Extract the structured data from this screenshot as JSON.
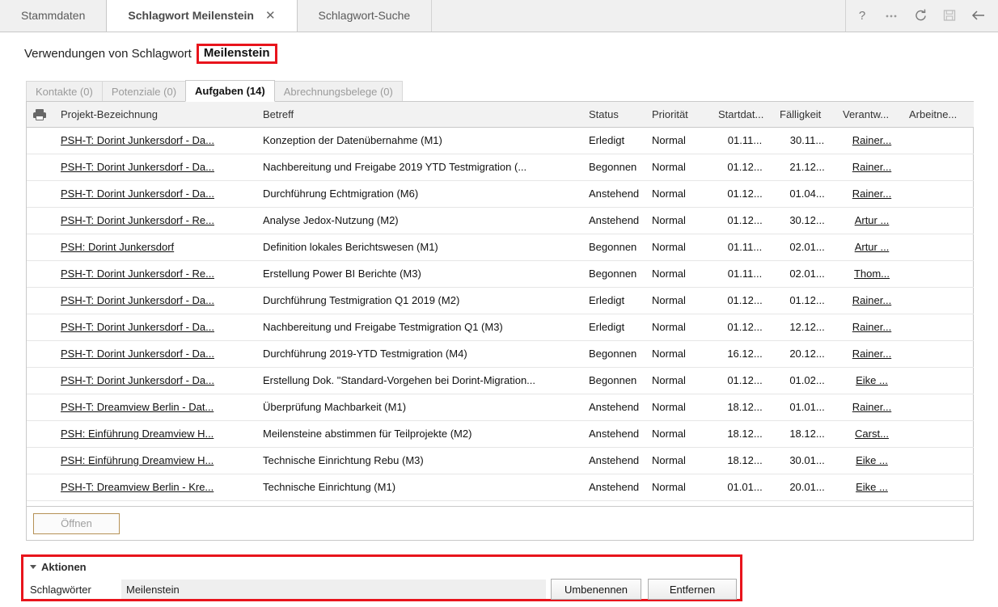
{
  "window": {
    "tabs": [
      {
        "label": "Stammdaten",
        "active": false,
        "closable": false
      },
      {
        "label": "Schlagwort Meilenstein",
        "active": true,
        "closable": true,
        "close_icon": "close-icon"
      },
      {
        "label": "Schlagwort-Suche",
        "active": false,
        "closable": false
      }
    ],
    "toolbar_icons": [
      {
        "name": "help-icon",
        "glyph": "?",
        "disabled": false
      },
      {
        "name": "more-options-icon",
        "glyph": "···",
        "disabled": false
      },
      {
        "name": "refresh-icon",
        "glyph": "↻",
        "disabled": false
      },
      {
        "name": "save-icon",
        "glyph": "὚b",
        "disabled": true
      },
      {
        "name": "back-arrow-icon",
        "glyph": "←",
        "disabled": false
      }
    ]
  },
  "header": {
    "prefix": "Verwendungen von Schlagwort",
    "keyword": "Meilenstein",
    "highlight_color": "#e8141c"
  },
  "subtabs": [
    {
      "label": "Kontakte (0)",
      "active": false
    },
    {
      "label": "Potenziale (0)",
      "active": false
    },
    {
      "label": "Aufgaben (14)",
      "active": true
    },
    {
      "label": "Abrechnungsbelege (0)",
      "active": false
    }
  ],
  "table": {
    "print_icon": "printer-icon",
    "columns": [
      "Projekt-Bezeichnung",
      "Betreff",
      "Status",
      "Priorität",
      "Startdat...",
      "Fälligkeit",
      "Verantw...",
      "Arbeitne..."
    ],
    "rows": [
      {
        "projekt": "PSH-T: Dorint Junkersdorf - Da...",
        "betreff": "Konzeption der Datenübernahme (M1)",
        "status": "Erledigt",
        "prio": "Normal",
        "start": "01.11...",
        "faellig": "30.11...",
        "verantw": "Rainer...",
        "arbeitn": ""
      },
      {
        "projekt": "PSH-T: Dorint Junkersdorf - Da...",
        "betreff": "Nachbereitung und Freigabe 2019 YTD Testmigration (...",
        "status": "Begonnen",
        "prio": "Normal",
        "start": "01.12...",
        "faellig": "21.12...",
        "verantw": "Rainer...",
        "arbeitn": ""
      },
      {
        "projekt": "PSH-T: Dorint Junkersdorf - Da...",
        "betreff": "Durchführung Echtmigration (M6)",
        "status": "Anstehend",
        "prio": "Normal",
        "start": "01.12...",
        "faellig": "01.04...",
        "verantw": "Rainer...",
        "arbeitn": ""
      },
      {
        "projekt": "PSH-T: Dorint Junkersdorf - Re...",
        "betreff": "Analyse Jedox-Nutzung (M2)",
        "status": "Anstehend",
        "prio": "Normal",
        "start": "01.12...",
        "faellig": "30.12...",
        "verantw": "Artur ...",
        "arbeitn": ""
      },
      {
        "projekt": "PSH: Dorint Junkersdorf",
        "betreff": "Definition lokales Berichtswesen (M1)",
        "status": "Begonnen",
        "prio": "Normal",
        "start": "01.11...",
        "faellig": "02.01...",
        "verantw": "Artur ...",
        "arbeitn": ""
      },
      {
        "projekt": "PSH-T: Dorint Junkersdorf - Re...",
        "betreff": "Erstellung Power BI Berichte (M3)",
        "status": "Begonnen",
        "prio": "Normal",
        "start": "01.11...",
        "faellig": "02.01...",
        "verantw": "Thom...",
        "arbeitn": ""
      },
      {
        "projekt": "PSH-T: Dorint Junkersdorf - Da...",
        "betreff": "Durchführung Testmigration Q1 2019 (M2)",
        "status": "Erledigt",
        "prio": "Normal",
        "start": "01.12...",
        "faellig": "01.12...",
        "verantw": "Rainer...",
        "arbeitn": ""
      },
      {
        "projekt": "PSH-T: Dorint Junkersdorf - Da...",
        "betreff": "Nachbereitung und Freigabe Testmigration Q1 (M3)",
        "status": "Erledigt",
        "prio": "Normal",
        "start": "01.12...",
        "faellig": "12.12...",
        "verantw": "Rainer...",
        "arbeitn": ""
      },
      {
        "projekt": "PSH-T: Dorint Junkersdorf - Da...",
        "betreff": "Durchführung 2019-YTD Testmigration (M4)",
        "status": "Begonnen",
        "prio": "Normal",
        "start": "16.12...",
        "faellig": "20.12...",
        "verantw": "Rainer...",
        "arbeitn": ""
      },
      {
        "projekt": "PSH-T: Dorint Junkersdorf - Da...",
        "betreff": "Erstellung Dok. \"Standard-Vorgehen bei Dorint-Migration...",
        "status": "Begonnen",
        "prio": "Normal",
        "start": "01.12...",
        "faellig": "01.02...",
        "verantw": "Eike ...",
        "arbeitn": ""
      },
      {
        "projekt": "PSH-T: Dreamview Berlin - Dat...",
        "betreff": "Überprüfung Machbarkeit (M1)",
        "status": "Anstehend",
        "prio": "Normal",
        "start": "18.12...",
        "faellig": "01.01...",
        "verantw": "Rainer...",
        "arbeitn": ""
      },
      {
        "projekt": "PSH: Einführung Dreamview H...",
        "betreff": "Meilensteine abstimmen für Teilprojekte (M2)",
        "status": "Anstehend",
        "prio": "Normal",
        "start": "18.12...",
        "faellig": "18.12...",
        "verantw": "Carst...",
        "arbeitn": ""
      },
      {
        "projekt": "PSH: Einführung Dreamview H...",
        "betreff": "Technische Einrichtung Rebu (M3)",
        "status": "Anstehend",
        "prio": "Normal",
        "start": "18.12...",
        "faellig": "30.01...",
        "verantw": "Eike ...",
        "arbeitn": ""
      },
      {
        "projekt": "PSH-T: Dreamview Berlin - Kre...",
        "betreff": "Technische Einrichtung (M1)",
        "status": "Anstehend",
        "prio": "Normal",
        "start": "01.01...",
        "faellig": "20.01...",
        "verantw": "Eike ...",
        "arbeitn": ""
      }
    ]
  },
  "open_bar": {
    "open_label": "Öffnen"
  },
  "aktionen": {
    "title": "Aktionen",
    "collapse_icon": "chevron-down-icon",
    "field_label": "Schlagwörter",
    "field_value": "Meilenstein",
    "rename_label": "Umbenennen",
    "remove_label": "Entfernen",
    "highlight_color": "#e8141c"
  }
}
